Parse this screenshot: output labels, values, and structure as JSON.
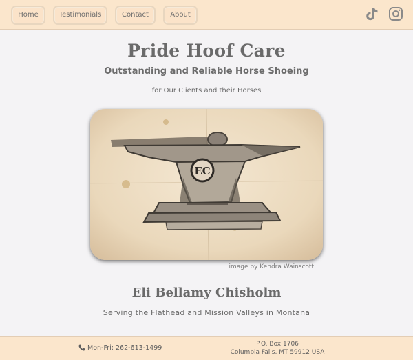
{
  "nav": {
    "items": [
      {
        "label": "Home"
      },
      {
        "label": "Testimonials"
      },
      {
        "label": "Contact"
      },
      {
        "label": "About"
      }
    ],
    "social": [
      "tiktok-icon",
      "instagram-icon"
    ]
  },
  "hero": {
    "title": "Pride Hoof Care",
    "subtitle": "Outstanding and Reliable Horse Shoeing",
    "tagline": "for Our Clients and their Horses"
  },
  "image": {
    "credit": "image by Kendra Wainscott",
    "monogram": "EC"
  },
  "owner": {
    "name": "Eli Bellamy Chisholm",
    "service_area": "Serving the Flathead and Mission Valleys in Montana"
  },
  "footer": {
    "phone": "Mon-Fri: 262-613-1499",
    "address_line1": "P.O. Box 1706",
    "address_line2": "Columbia Falls, MT 59912 USA"
  },
  "colors": {
    "bar": "#fbe6cc",
    "page": "#f4f3f5",
    "text": "#6a6a6a"
  }
}
